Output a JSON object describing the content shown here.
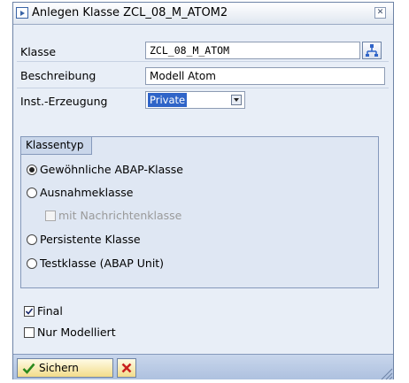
{
  "window": {
    "title": "Anlegen Klasse ZCL_08_M_ATOM2",
    "close_icon": "close-icon"
  },
  "form": {
    "klasse_label": "Klasse",
    "klasse_value": "ZCL_08_M_ATOM",
    "beschreibung_label": "Beschreibung",
    "beschreibung_value": "Modell Atom",
    "inst_label": "Inst.-Erzeugung",
    "inst_value": "Private"
  },
  "klassentyp": {
    "header": "Klassentyp",
    "options": [
      {
        "label": "Gewöhnliche ABAP-Klasse",
        "selected": true
      },
      {
        "label": "Ausnahmeklasse",
        "selected": false
      },
      {
        "label": "Persistente Klasse",
        "selected": false
      },
      {
        "label": "Testklasse (ABAP Unit)",
        "selected": false
      }
    ],
    "nachrichten_label": "mit Nachrichtenklasse",
    "nachrichten_enabled": false
  },
  "flags": {
    "final_label": "Final",
    "final_checked": true,
    "modelliert_label": "Nur Modelliert",
    "modelliert_checked": false
  },
  "footer": {
    "save_label": "Sichern"
  },
  "colors": {
    "accent": "#2f64c8",
    "dialog_bg": "#e8eef7",
    "button_bg": "#f2dc8a",
    "cancel_red": "#c8201e"
  }
}
